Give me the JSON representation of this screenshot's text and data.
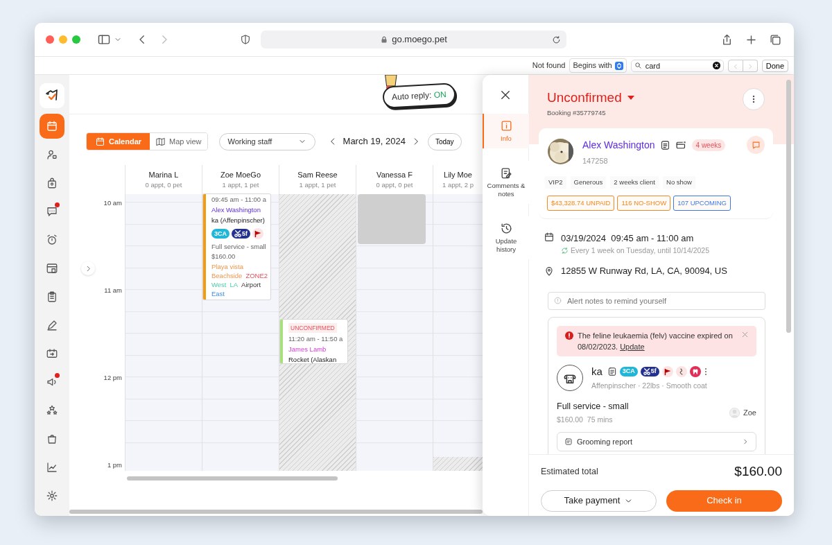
{
  "browser": {
    "url": "go.moego.pet"
  },
  "find_bar": {
    "status": "Not found",
    "mode": "Begins with",
    "query": "card",
    "done": "Done"
  },
  "sidebar": {
    "items": [
      {
        "kind": "calendar",
        "selected": true,
        "notification": false
      },
      {
        "kind": "person",
        "selected": false,
        "notification": false
      },
      {
        "kind": "bag",
        "selected": false,
        "notification": false
      },
      {
        "kind": "chat",
        "selected": false,
        "notification": true
      },
      {
        "kind": "alarm",
        "selected": false,
        "notification": false
      },
      {
        "kind": "store",
        "selected": false,
        "notification": false
      },
      {
        "kind": "clipboard",
        "selected": false,
        "notification": false
      },
      {
        "kind": "pen",
        "selected": false,
        "notification": false
      },
      {
        "kind": "ticket",
        "selected": false,
        "notification": false
      },
      {
        "kind": "megaphone",
        "selected": false,
        "notification": true
      },
      {
        "kind": "stars",
        "selected": false,
        "notification": false
      },
      {
        "kind": "basket",
        "selected": false,
        "notification": false
      },
      {
        "kind": "chart",
        "selected": false,
        "notification": false
      },
      {
        "kind": "gear",
        "selected": false,
        "notification": false
      }
    ]
  },
  "auto_reply": {
    "label": "Auto reply:",
    "state": "ON"
  },
  "toolbar": {
    "views": [
      {
        "kind": "calendar",
        "label": "Calendar",
        "selected": true
      },
      {
        "kind": "map",
        "label": "Map view",
        "selected": false
      }
    ],
    "staff_filter": "Working staff",
    "date": "March 19, 2024",
    "today": "Today"
  },
  "calendar": {
    "times": [
      "10 am",
      "11 am",
      "12 pm",
      "1 pm"
    ],
    "staff": [
      {
        "name": "Marina L",
        "summary": "0 appt, 0 pet",
        "unavailable": false
      },
      {
        "name": "Zoe MoeGo",
        "summary": "1 appt, 1 pet",
        "unavailable": false,
        "appointments": [
          {
            "color": "#f39c12",
            "time": "09:45 am - 11:00 a",
            "client": "Alex Washington",
            "pet": "ka (Affenpinscher)",
            "tags": [
              {
                "kind": "plain",
                "text": "3CA",
                "color": "#1fb6d8"
              },
              {
                "kind": "groom",
                "text": "5f",
                "color": "#25318f"
              }
            ],
            "service": "Full service - small",
            "price": "$160.00",
            "areas": [
              "Playa vista",
              "Beachside",
              "ZONE2",
              "West",
              "LA",
              "Airport",
              "East"
            ]
          }
        ]
      },
      {
        "name": "Sam Reese",
        "summary": "1 appt, 1 pet",
        "unavailable": true,
        "appointments": [
          {
            "color": "#a8e07c",
            "status": "UNCONFIRMED",
            "time": "11:20 am - 11:50 a",
            "client": "James Lamb",
            "pet": "Rocket (Alaskan"
          }
        ]
      },
      {
        "name": "Vanessa F",
        "summary": "0 appt, 0 pet",
        "unavailable": false,
        "blocks": [
          {
            "kind": "busy"
          }
        ]
      },
      {
        "name": "Lily Moe",
        "summary": "1 appt, 2 p",
        "unavailable": false,
        "blocks": [
          {
            "kind": "hatched"
          }
        ]
      }
    ]
  },
  "drawer": {
    "tabs": [
      {
        "kind": "info",
        "label": "Info",
        "selected": true
      },
      {
        "kind": "notes",
        "label": "Comments & notes",
        "selected": false
      },
      {
        "kind": "history",
        "label": "Update history",
        "selected": false
      }
    ],
    "status": "Unconfirmed",
    "booking": "Booking #35779745",
    "client": {
      "name": "Alex Washington",
      "id": "147258",
      "frequency": "4 weeks",
      "tags": [
        "VIP2",
        "Generous",
        "2 weeks client",
        "No show"
      ],
      "stats": [
        {
          "text": "$43,328.74 UNPAID",
          "color": "#f08a24"
        },
        {
          "text": "116 NO-SHOW",
          "color": "#f08a24"
        },
        {
          "text": "107 UPCOMING",
          "color": "#3b7be8"
        }
      ]
    },
    "schedule": {
      "datetime": "03/19/2024  09:45 am - 11:00 am",
      "repeat": "Every 1 week on Tuesday, until 10/14/2025"
    },
    "address": "12855 W Runway Rd, LA, CA, 90094, US",
    "alert_notes": {
      "placeholder": "Alert notes to remind yourself"
    },
    "pet_card": {
      "warning": "The feline leukaemia (felv) vaccine expired on 08/02/2023.",
      "warning_link": "Update",
      "pet": {
        "name": "ka",
        "details": "Affenpinscher · 22lbs · Smooth coat",
        "tags": [
          {
            "kind": "plain",
            "text": "3CA",
            "color": "#1fb6d8"
          },
          {
            "kind": "groom",
            "text": "5f",
            "color": "#25318f"
          }
        ]
      },
      "service": {
        "name": "Full service - small",
        "price": "$160.00",
        "duration": "75 mins",
        "staff": "Zoe"
      },
      "report": "Grooming report"
    },
    "footer": {
      "total_label": "Estimated total",
      "total": "$160.00",
      "payment": "Take payment",
      "check_in": "Check in"
    }
  }
}
